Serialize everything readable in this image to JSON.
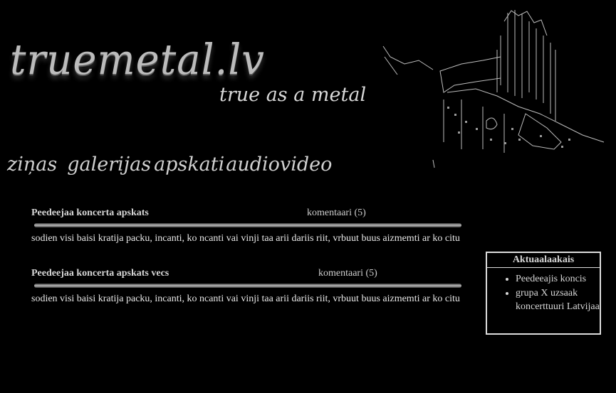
{
  "header": {
    "logo": "truemetal.lv",
    "tagline": "true as a metal"
  },
  "nav": [
    "ziņas",
    "galerijas",
    "apskati",
    "audio",
    "video"
  ],
  "articles": [
    {
      "title": "Peedeejaa koncerta apskats",
      "comments": "komentaari (5)",
      "body": "sodien visi baisi kratija packu, incanti, ko ncanti vai vinji taa arii dariis riit, vrbuut buus aizmemti ar ko citu"
    },
    {
      "title": "Peedeejaa koncerta apskats vecs",
      "comments": "komentaari (5)",
      "body": "sodien visi baisi kratija packu, incanti, ko ncanti vai vinji taa arii dariis riit, vrbuut buus aizmemti ar ko citu"
    }
  ],
  "sidebar": {
    "title": "Aktuaalaakais",
    "items": [
      "Peedeeajis koncis",
      "grupa X uzsaak koncerttuuri Latvijaa"
    ]
  },
  "colors": {
    "background": "#000000",
    "text": "#e8e8e8",
    "border": "#dddddd"
  }
}
